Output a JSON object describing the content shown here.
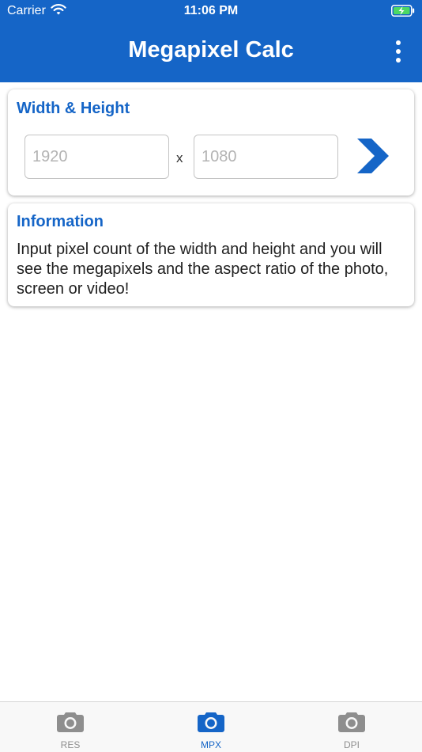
{
  "status_bar": {
    "carrier": "Carrier",
    "time": "11:06 PM",
    "wifi_icon": "wifi-icon",
    "battery_icon": "battery-charging-icon"
  },
  "header": {
    "title": "Megapixel Calc",
    "menu_icon": "more-vertical-icon",
    "background_color": "#1565c7"
  },
  "dimensions_card": {
    "title": "Width & Height",
    "width_placeholder": "1920",
    "height_placeholder": "1080",
    "width_value": "",
    "height_value": "",
    "separator": "x",
    "go_icon": "chevron-right-icon"
  },
  "info_card": {
    "title": "Information",
    "text": "Input pixel count of the width and height and you will see the megapixels and the aspect ratio of the photo, screen or video!"
  },
  "tabs": [
    {
      "label": "RES",
      "icon": "camera-icon",
      "active": false
    },
    {
      "label": "MPX",
      "icon": "camera-icon",
      "active": true
    },
    {
      "label": "DPI",
      "icon": "camera-icon",
      "active": false
    }
  ],
  "colors": {
    "accent": "#1565c7",
    "inactive_tab": "#8e8e8e"
  }
}
